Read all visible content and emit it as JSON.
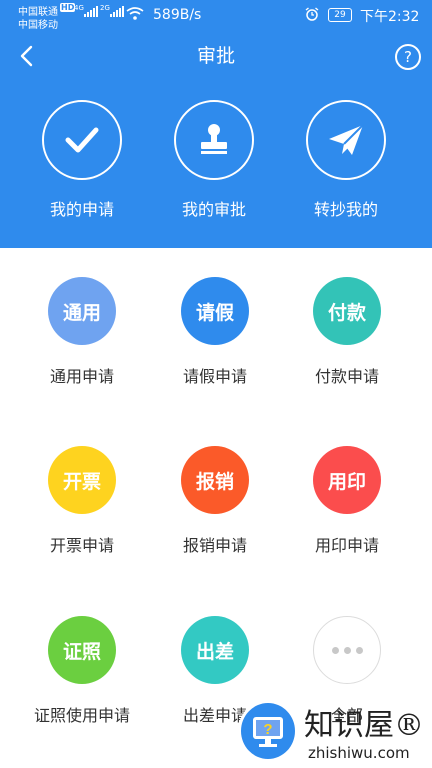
{
  "status_bar": {
    "carrier_1": "中国联通",
    "carrier_2": "中国移动",
    "network_badge": "HD",
    "net_label_1": "4G",
    "net_label_2": "2G",
    "speed": "589B/s",
    "battery": "29",
    "time": "下午2:32"
  },
  "header": {
    "title": "审批",
    "help_label": "?"
  },
  "top_actions": [
    {
      "label": "我的申请",
      "icon": "check-icon"
    },
    {
      "label": "我的审批",
      "icon": "stamp-icon"
    },
    {
      "label": "转抄我的",
      "icon": "paper-plane-icon"
    }
  ],
  "apply_items": [
    {
      "icon_text": "通用",
      "label": "通用申请",
      "color": "#6fa3f0"
    },
    {
      "icon_text": "请假",
      "label": "请假申请",
      "color": "#2f8bed"
    },
    {
      "icon_text": "付款",
      "label": "付款申请",
      "color": "#33c3b7"
    },
    {
      "icon_text": "开票",
      "label": "开票申请",
      "color": "#fed31f"
    },
    {
      "icon_text": "报销",
      "label": "报销申请",
      "color": "#fb5a29"
    },
    {
      "icon_text": "用印",
      "label": "用印申请",
      "color": "#fb4d4d"
    },
    {
      "icon_text": "证照",
      "label": "证照使用申请",
      "color": "#6bcf40"
    },
    {
      "icon_text": "出差",
      "label": "出差申请",
      "color": "#33c9c3"
    },
    {
      "icon_text": "",
      "label": "全部",
      "color": "#ffffff"
    }
  ],
  "watermark": {
    "title": "知识屋®",
    "subtitle": "zhishiwu.com"
  }
}
